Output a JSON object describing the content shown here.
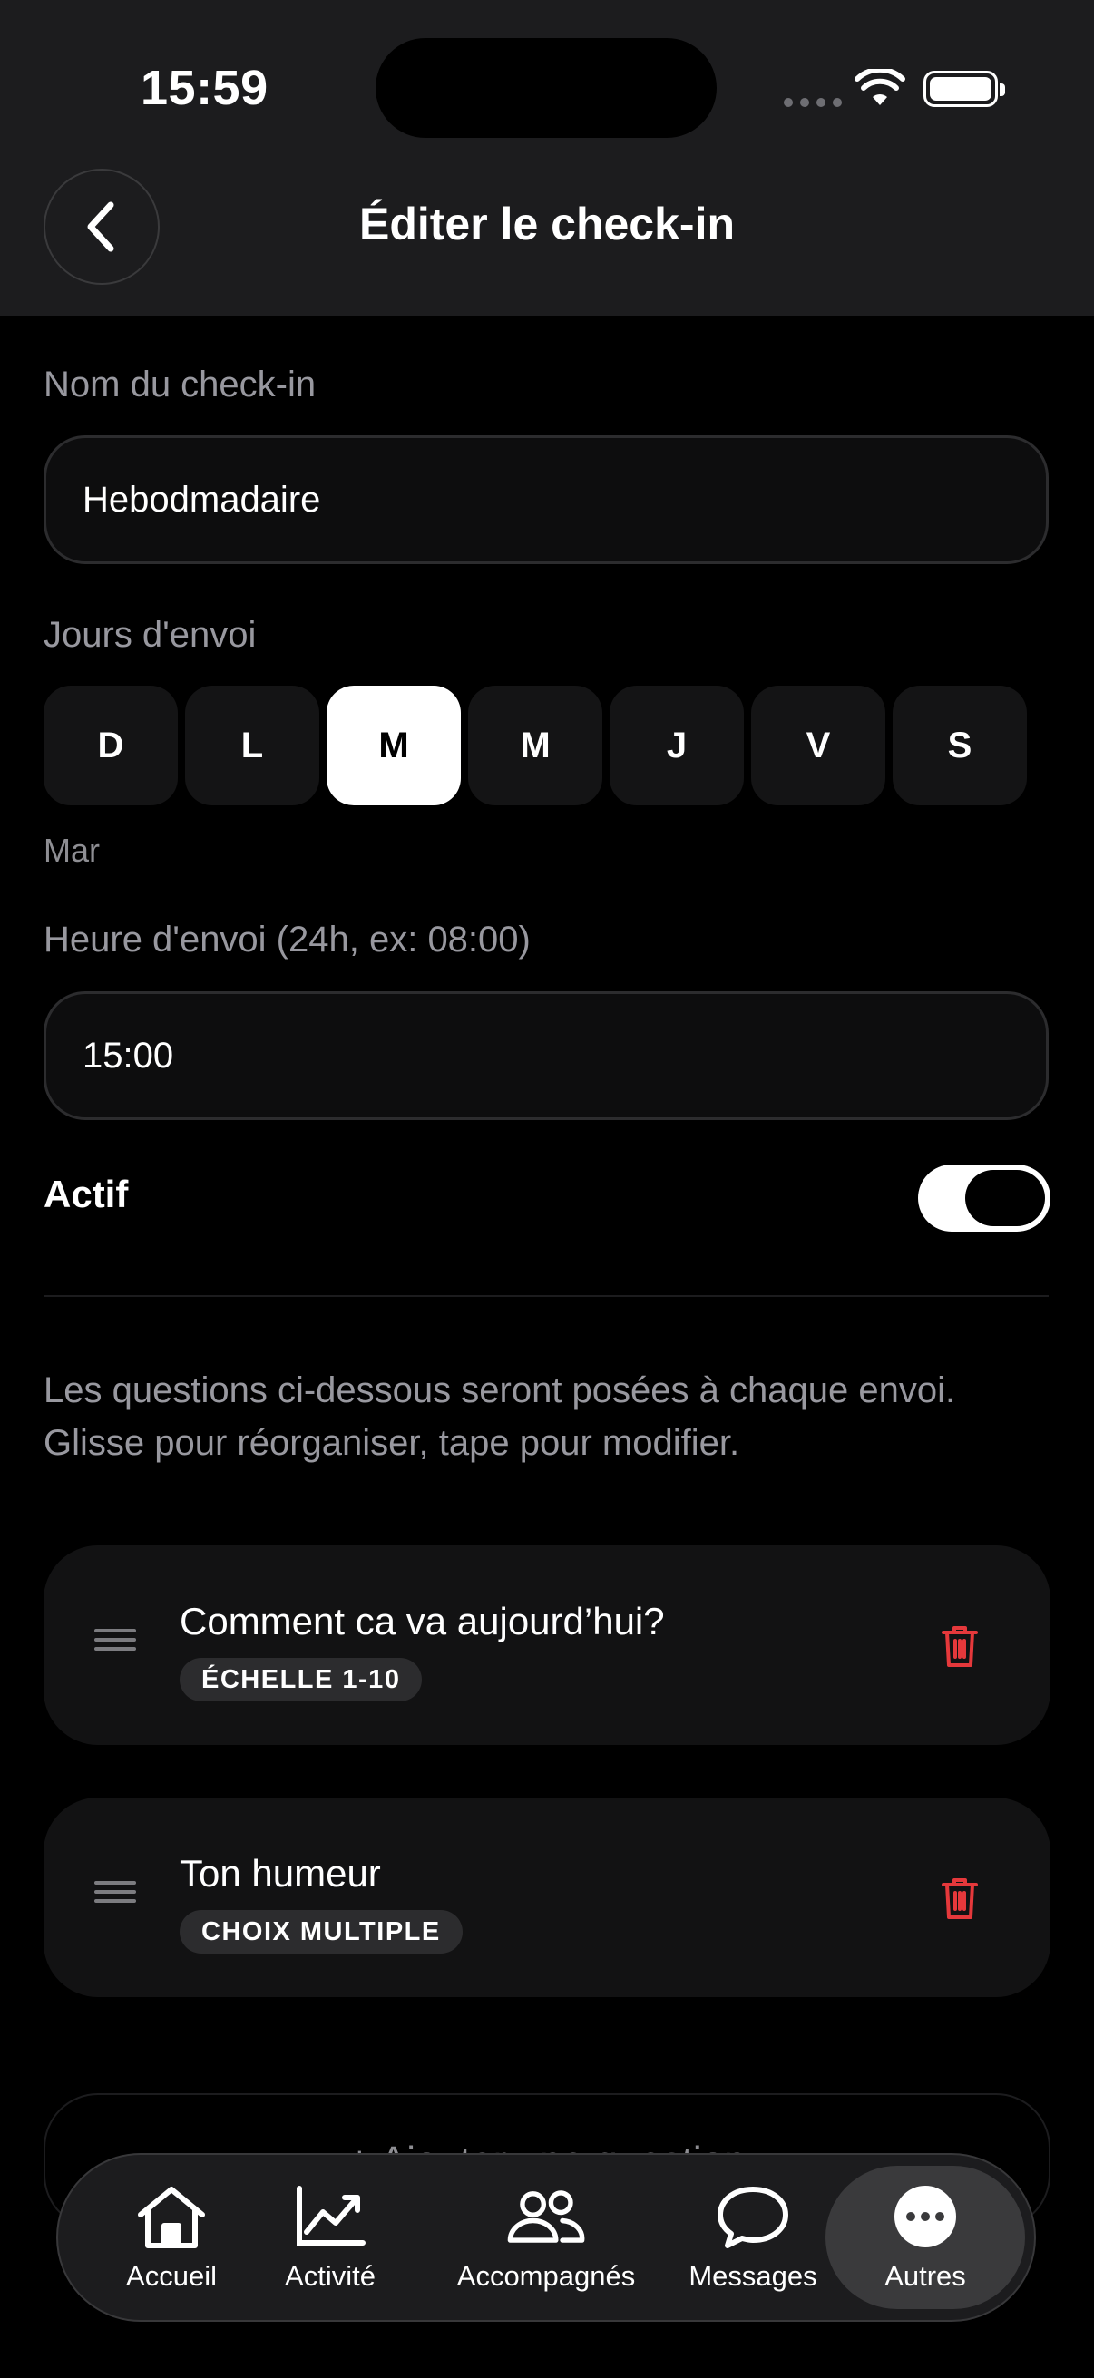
{
  "status_bar": {
    "time": "15:59"
  },
  "header": {
    "title": "Éditer le check-in",
    "back_icon": "chevron-left-icon"
  },
  "form": {
    "name_label": "Nom du check-in",
    "name_value": "Hebodmadaire",
    "days_label": "Jours d'envoi",
    "days": [
      {
        "label": "D",
        "selected": false
      },
      {
        "label": "L",
        "selected": false
      },
      {
        "label": "M",
        "selected": true
      },
      {
        "label": "M",
        "selected": false
      },
      {
        "label": "J",
        "selected": false
      },
      {
        "label": "V",
        "selected": false
      },
      {
        "label": "S",
        "selected": false
      }
    ],
    "selected_days_caption": "Mar",
    "time_label": "Heure d'envoi (24h, ex: 08:00)",
    "time_value": "15:00",
    "active_label": "Actif",
    "active": true
  },
  "questions_help": "Les questions ci-dessous seront posées à chaque envoi. Glisse pour réorganiser, tape pour modifier.",
  "questions": [
    {
      "title": "Comment ca va aujourd’hui?",
      "type": "ÉCHELLE 1-10"
    },
    {
      "title": "Ton humeur",
      "type": "CHOIX MULTIPLE"
    }
  ],
  "add_question_label": "+ Ajouter une question",
  "tab_bar": {
    "items": [
      {
        "label": "Accueil",
        "icon": "home-icon",
        "active": false
      },
      {
        "label": "Activité",
        "icon": "chart-trend-icon",
        "active": false
      },
      {
        "label": "Accompagnés",
        "icon": "people-icon",
        "active": false
      },
      {
        "label": "Messages",
        "icon": "chat-bubble-icon",
        "active": false
      },
      {
        "label": "Autres",
        "icon": "more-icon",
        "active": true
      }
    ]
  },
  "colors": {
    "background": "#000000",
    "surface": "#1c1c1e",
    "delete": "#e5383b",
    "selected_day": "#ffffff"
  }
}
